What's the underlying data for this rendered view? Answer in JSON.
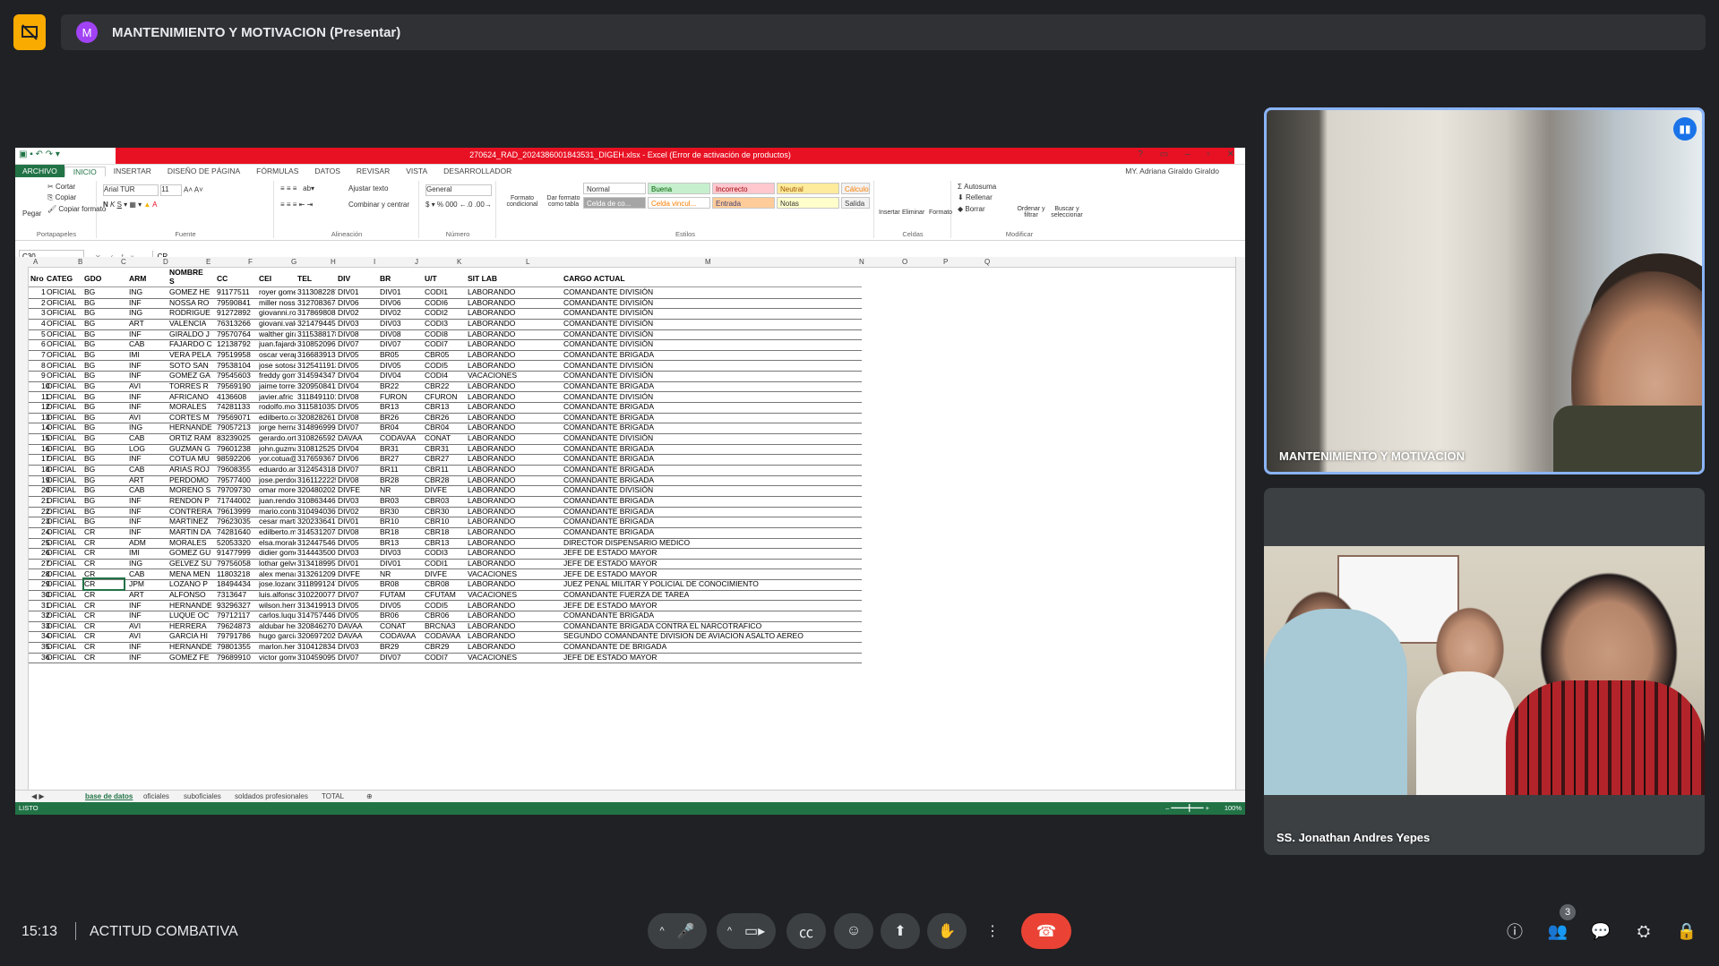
{
  "meeting": {
    "presenting_title": "MANTENIMIENTO Y MOTIVACION (Presentar)",
    "avatar_letter": "M",
    "time": "15:13",
    "meeting_name": "ACTITUD COMBATIVA",
    "participant_count": "3"
  },
  "tiles": [
    {
      "name": "MANTENIMIENTO Y MOTIVACION"
    },
    {
      "name": "SS. Jonathan Andres Yepes"
    }
  ],
  "excel": {
    "doc_title": "270624_RAD_2024386001843531_DIGEH.xlsx - Excel (Error de activación de productos)",
    "tabs": [
      "ARCHIVO",
      "INICIO",
      "INSERTAR",
      "DISEÑO DE PÁGINA",
      "FÓRMULAS",
      "DATOS",
      "REVISAR",
      "VISTA",
      "DESARROLLADOR"
    ],
    "user": "MY. Adriana Giraldo Giraldo",
    "clipboard": {
      "paste": "Pegar",
      "cut": "Cortar",
      "copy": "Copiar",
      "format": "Copiar formato",
      "group": "Portapapeles"
    },
    "font": {
      "name": "Arial TUR",
      "size": "11",
      "group": "Fuente"
    },
    "alignment": {
      "wrap": "Ajustar texto",
      "merge": "Combinar y centrar",
      "group": "Alineación"
    },
    "number": {
      "format": "General",
      "group": "Número"
    },
    "styles": {
      "cond": "Formato condicional",
      "table": "Dar formato como tabla",
      "group": "Estilos",
      "items": [
        "Normal",
        "Buena",
        "Incorrecto",
        "Neutral",
        "Cálculo",
        "Celda de co...",
        "Celda vincul...",
        "Entrada",
        "Notas",
        "Salida"
      ]
    },
    "cells": {
      "insert": "Insertar",
      "delete": "Eliminar",
      "format": "Formato",
      "group": "Celdas"
    },
    "editing": {
      "autosum": "Autosuma",
      "fill": "Rellenar",
      "clear": "Borrar",
      "sort": "Ordenar y filtrar",
      "find": "Buscar y seleccionar",
      "group": "Modificar"
    },
    "name_box": "C30",
    "formula_value": "CR",
    "col_letters": [
      "A",
      "B",
      "C",
      "D",
      "E",
      "F",
      "G",
      "H",
      "I",
      "J",
      "K",
      "L",
      "M",
      "N",
      "O",
      "P",
      "Q"
    ],
    "headers": [
      "Nro",
      "CATEG",
      "GDO",
      "ARM",
      "NOMBRE S",
      "CC",
      "CEI",
      "TEL",
      "DIV",
      "BR",
      "U/T",
      "SIT LAB",
      "CARGO ACTUAL"
    ],
    "rows": [
      [
        "1",
        "OFICIAL",
        "BG",
        "ING",
        "GOMEZ HE",
        "91177511",
        "royer gome",
        "3113082287",
        "DIV01",
        "DIV01",
        "CODI1",
        "LABORANDO",
        "COMANDANTE DIVISIÓN"
      ],
      [
        "2",
        "OFICIAL",
        "BG",
        "INF",
        "NOSSA RO",
        "79590841",
        "miller nossa",
        "3127083674",
        "DIV06",
        "DIV06",
        "CODI6",
        "LABORANDO",
        "COMANDANTE DIVISIÓN"
      ],
      [
        "3",
        "OFICIAL",
        "BG",
        "ING",
        "RODRIGUE",
        "91272892",
        "giovanni.ro",
        "3178698083",
        "DIV02",
        "DIV02",
        "CODI2",
        "LABORANDO",
        "COMANDANTE DIVISIÓN"
      ],
      [
        "4",
        "OFICIAL",
        "BG",
        "ART",
        "VALENCIA",
        "76313266",
        "giovani.vale",
        "3214794453",
        "DIV03",
        "DIV03",
        "CODI3",
        "LABORANDO",
        "COMANDANTE DIVISIÓN"
      ],
      [
        "5",
        "OFICIAL",
        "BG",
        "INF",
        "GIRALDO J",
        "79570764",
        "walther gira",
        "3115388178",
        "DIV08",
        "DIV08",
        "CODI8",
        "LABORANDO",
        "COMANDANTE DIVISIÓN"
      ],
      [
        "6",
        "OFICIAL",
        "BG",
        "CAB",
        "FAJARDO C",
        "12138792",
        "juan.fajardo",
        "3108520967",
        "DIV07",
        "DIV07",
        "CODI7",
        "LABORANDO",
        "COMANDANTE DIVISIÓN"
      ],
      [
        "7",
        "OFICIAL",
        "BG",
        "IMI",
        "VERA PELA",
        "79519958",
        "oscar verap",
        "3166839133",
        "DIV05",
        "BR05",
        "CBR05",
        "LABORANDO",
        "COMANDANTE BRIGADA"
      ],
      [
        "8",
        "OFICIAL",
        "BG",
        "INF",
        "SOTO SAN",
        "79538104",
        "jose sotosa",
        "3125411913",
        "DIV05",
        "DIV05",
        "CODI5",
        "LABORANDO",
        "COMANDANTE DIVISIÓN"
      ],
      [
        "9",
        "OFICIAL",
        "BG",
        "INF",
        "GOMEZ GA",
        "79545603",
        "freddy gom",
        "3145943478",
        "DIV04",
        "DIV04",
        "CODI4",
        "VACACIONES",
        "COMANDANTE DIVISIÓN"
      ],
      [
        "10",
        "OFICIAL",
        "BG",
        "AVI",
        "TORRES R",
        "79569190",
        "jaime torres",
        "3209508411",
        "DIV04",
        "BR22",
        "CBR22",
        "LABORANDO",
        "COMANDANTE BRIGADA"
      ],
      [
        "11",
        "OFICIAL",
        "BG",
        "INF",
        "AFRICANO",
        "4136608",
        "javier.afric",
        "3118491101",
        "DIV08",
        "FURON",
        "CFURON",
        "LABORANDO",
        "COMANDANTE DIVISIÓN"
      ],
      [
        "12",
        "OFICIAL",
        "BG",
        "INF",
        "MORALES",
        "74281133",
        "rodolfo.mor",
        "3115810353",
        "DIV05",
        "BR13",
        "CBR13",
        "LABORANDO",
        "COMANDANTE BRIGADA"
      ],
      [
        "13",
        "OFICIAL",
        "BG",
        "AVI",
        "CORTES M",
        "79569071",
        "edilberto.co",
        "3208282612",
        "DIV08",
        "BR26",
        "CBR26",
        "LABORANDO",
        "COMANDANTE BRIGADA"
      ],
      [
        "14",
        "OFICIAL",
        "BG",
        "ING",
        "HERNANDE",
        "79057213",
        "jorge hernar",
        "3148969994",
        "DIV07",
        "BR04",
        "CBR04",
        "LABORANDO",
        "COMANDANTE BRIGADA"
      ],
      [
        "15",
        "OFICIAL",
        "BG",
        "CAB",
        "ORTIZ RAM",
        "83239025",
        "gerardo.ort",
        "3108265926",
        "DAVAA",
        "CODAVAA",
        "CONAT",
        "LABORANDO",
        "COMANDANTE DIVISIÓN"
      ],
      [
        "16",
        "OFICIAL",
        "BG",
        "LOG",
        "GUZMAN G",
        "79601238",
        "john.guzma",
        "3108125253",
        "DIV04",
        "BR31",
        "CBR31",
        "LABORANDO",
        "COMANDANTE BRIGADA"
      ],
      [
        "17",
        "OFICIAL",
        "BG",
        "INF",
        "COTUA MU",
        "98592206",
        "yor.cotua@",
        "3176593672",
        "DIV06",
        "BR27",
        "CBR27",
        "LABORANDO",
        "COMANDANTE BRIGADA"
      ],
      [
        "18",
        "OFICIAL",
        "BG",
        "CAB",
        "ARIAS ROJ",
        "79608355",
        "eduardo.ari",
        "3124543184",
        "DIV07",
        "BR11",
        "CBR11",
        "LABORANDO",
        "COMANDANTE BRIGADA"
      ],
      [
        "19",
        "OFICIAL",
        "BG",
        "ART",
        "PERDOMO",
        "79577400",
        "jose.perdon",
        "3161122225",
        "DIV08",
        "BR28",
        "CBR28",
        "LABORANDO",
        "COMANDANTE BRIGADA"
      ],
      [
        "20",
        "OFICIAL",
        "BG",
        "CAB",
        "MORENO S",
        "79709730",
        "omar morer",
        "3204802022",
        "DIVFE",
        "NR",
        "DIVFE",
        "LABORANDO",
        "COMANDANTE DIVISIÓN"
      ],
      [
        "21",
        "OFICIAL",
        "BG",
        "INF",
        "RENDON P",
        "71744002",
        "juan.rendon",
        "3108634462",
        "DIV03",
        "BR03",
        "CBR03",
        "LABORANDO",
        "COMANDANTE BRIGADA"
      ],
      [
        "22",
        "OFICIAL",
        "BG",
        "INF",
        "CONTRERA",
        "79613999",
        "mario.contr",
        "3104940360",
        "DIV02",
        "BR30",
        "CBR30",
        "LABORANDO",
        "COMANDANTE BRIGADA"
      ],
      [
        "23",
        "OFICIAL",
        "BG",
        "INF",
        "MARTINEZ",
        "79623035",
        "cesar marti",
        "3202336413",
        "DIV01",
        "BR10",
        "CBR10",
        "LABORANDO",
        "COMANDANTE BRIGADA"
      ],
      [
        "24",
        "OFICIAL",
        "CR",
        "INF",
        "MARTIN DA",
        "74281640",
        "edilberto.m",
        "3145312074",
        "DIV08",
        "BR18",
        "CBR18",
        "LABORANDO",
        "COMANDANTE BRIGADA"
      ],
      [
        "25",
        "OFICIAL",
        "CR",
        "ADM",
        "MORALES",
        "52053320",
        "elsa.morale",
        "3124475461",
        "DIV05",
        "BR13",
        "CBR13",
        "LABORANDO",
        "DIRECTOR DISPENSARIO MEDICO"
      ],
      [
        "26",
        "OFICIAL",
        "CR",
        "IMI",
        "GOMEZ GU",
        "91477999",
        "didier gome",
        "3144435006",
        "DIV03",
        "DIV03",
        "CODI3",
        "LABORANDO",
        "JEFE DE ESTADO MAYOR"
      ],
      [
        "27",
        "OFICIAL",
        "CR",
        "ING",
        "GELVEZ SU",
        "79756058",
        "lothar gelve",
        "3134189952",
        "DIV01",
        "DIV01",
        "CODI1",
        "LABORANDO",
        "JEFE DE ESTADO MAYOR"
      ],
      [
        "28",
        "OFICIAL",
        "CR",
        "CAB",
        "MENA MEN",
        "11803218",
        "alex mena@",
        "3132612094",
        "DIVFE",
        "NR",
        "DIVFE",
        "VACACIONES",
        "JEFE DE ESTADO MAYOR"
      ],
      [
        "29",
        "OFICIAL",
        "CR",
        "JPM",
        "LOZANO P",
        "18494434",
        "jose.lozano",
        "3118991247",
        "DIV05",
        "BR08",
        "CBR08",
        "LABORANDO",
        "JUEZ PENAL MILITAR Y POLICIAL DE CONOCIMIENTO"
      ],
      [
        "30",
        "OFICIAL",
        "CR",
        "ART",
        "ALFONSO",
        "7313647",
        "luis.alfonso",
        "3102200778",
        "DIV07",
        "FUTAM",
        "CFUTAM",
        "VACACIONES",
        "COMANDANTE FUERZA DE TAREA"
      ],
      [
        "31",
        "OFICIAL",
        "CR",
        "INF",
        "HERNANDE",
        "93296327",
        "wilson.hern",
        "3134199133",
        "DIV05",
        "DIV05",
        "CODI5",
        "LABORANDO",
        "JEFE DE ESTADO MAYOR"
      ],
      [
        "32",
        "OFICIAL",
        "CR",
        "INF",
        "LUQUE OC",
        "79712117",
        "carlos.luque",
        "3147574464",
        "DIV05",
        "BR06",
        "CBR06",
        "LABORANDO",
        "COMANDANTE BRIGADA"
      ],
      [
        "33",
        "OFICIAL",
        "CR",
        "AVI",
        "HERRERA",
        "79624873",
        "aldubar her",
        "3208462700",
        "DAVAA",
        "CONAT",
        "BRCNA3",
        "LABORANDO",
        "COMANDANTE BRIGADA CONTRA EL NARCOTRAFICO"
      ],
      [
        "34",
        "OFICIAL",
        "CR",
        "AVI",
        "GARCIA HI",
        "79791786",
        "hugo garcia",
        "3206972020",
        "DAVAA",
        "CODAVAA",
        "CODAVAA",
        "LABORANDO",
        "SEGUNDO COMANDANTE DIVISION DE AVIACION ASALTO AEREO"
      ],
      [
        "35",
        "OFICIAL",
        "CR",
        "INF",
        "HERNANDE",
        "79801355",
        "marlon.hern",
        "3104128341",
        "DIV03",
        "BR29",
        "CBR29",
        "LABORANDO",
        "COMANDANTE DE BRIGADA"
      ],
      [
        "36",
        "OFICIAL",
        "CR",
        "INF",
        "GOMEZ FE",
        "79689910",
        "victor gome",
        "3104590952",
        "DIV07",
        "DIV07",
        "CODI7",
        "VACACIONES",
        "JEFE DE ESTADO MAYOR"
      ]
    ],
    "sheet_tabs": [
      "base de datos",
      "oficiales",
      "suboficiales",
      "soldados profesionales",
      "TOTAL"
    ],
    "status": {
      "ready": "LISTO",
      "zoom": "100%"
    }
  },
  "controls": {
    "hangup_color": "#ea4335",
    "accent": "#8ab4f8",
    "present_color": "#f9ab00"
  }
}
